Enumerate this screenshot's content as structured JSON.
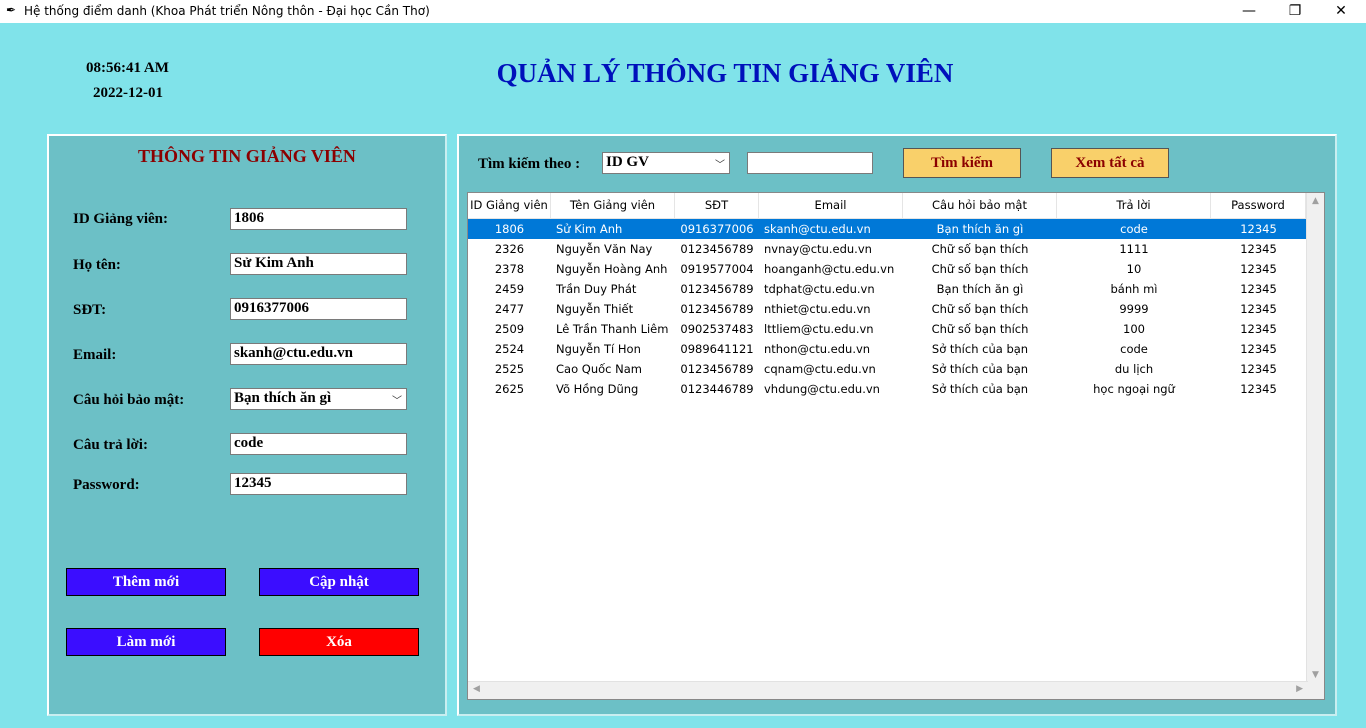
{
  "window": {
    "title": "Hệ thống điểm danh (Khoa Phát triển Nông thôn - Đại học Cần Thơ)",
    "app_icon": "feather-icon",
    "min_glyph": "—",
    "max_glyph": "❐",
    "close_glyph": "✕"
  },
  "clock": {
    "time": "08:56:41 AM",
    "date": "2022-12-01"
  },
  "page_title": "QUẢN LÝ THÔNG TIN GIẢNG VIÊN",
  "form": {
    "title": "THÔNG TIN GIẢNG VIÊN",
    "id_label": "ID Giảng viên:",
    "id_value": "1806",
    "name_label": "Họ tên:",
    "name_value": "Sử Kim Anh",
    "phone_label": "SĐT:",
    "phone_value": "0916377006",
    "email_label": "Email:",
    "email_value": "skanh@ctu.edu.vn",
    "question_label": "Câu hỏi bảo mật:",
    "question_value": "Bạn thích ăn gì",
    "answer_label": "Câu trả lời:",
    "answer_value": "code",
    "password_label": "Password:",
    "password_value": "12345"
  },
  "buttons": {
    "add": "Thêm mới",
    "update": "Cập nhật",
    "reset": "Làm mới",
    "delete": "Xóa"
  },
  "search": {
    "label": "Tìm kiếm theo :",
    "by_value": "ID GV",
    "query_value": "",
    "search_button": "Tìm kiếm",
    "show_all_button": "Xem tất cả"
  },
  "table": {
    "columns": [
      "ID Giảng viên",
      "Tên Giảng viên",
      "SĐT",
      "Email",
      "Câu hỏi bảo mật",
      "Trả lời",
      "Password"
    ],
    "rows": [
      [
        "1806",
        "Sử Kim Anh",
        "0916377006",
        "skanh@ctu.edu.vn",
        "Bạn thích ăn gì",
        "code",
        "12345"
      ],
      [
        "2326",
        "Nguyễn Văn Nay",
        "0123456789",
        "nvnay@ctu.edu.vn",
        "Chữ số bạn thích",
        "1111",
        "12345"
      ],
      [
        "2378",
        "Nguyễn Hoàng Anh",
        "0919577004",
        "hoanganh@ctu.edu.vn",
        "Chữ số bạn thích",
        "10",
        "12345"
      ],
      [
        "2459",
        "Trần Duy Phát",
        "0123456789",
        "tdphat@ctu.edu.vn",
        "Bạn thích ăn gì",
        "bánh mì",
        "12345"
      ],
      [
        "2477",
        "Nguyễn Thiết",
        "0123456789",
        "nthiet@ctu.edu.vn",
        "Chữ số bạn thích",
        "9999",
        "12345"
      ],
      [
        "2509",
        "Lê Trần Thanh Liêm",
        "0902537483",
        "lttliem@ctu.edu.vn",
        "Chữ số bạn thích",
        "100",
        "12345"
      ],
      [
        "2524",
        "Nguyễn Tí Hon",
        "0989641121",
        "nthon@ctu.edu.vn",
        "Sở thích của bạn",
        "code",
        "12345"
      ],
      [
        "2525",
        "Cao Quốc Nam",
        "0123456789",
        "cqnam@ctu.edu.vn",
        "Sở thích của bạn",
        "du lịch",
        "12345"
      ],
      [
        "2625",
        "Võ Hồng Dũng",
        "0123446789",
        "vhdung@ctu.edu.vn",
        "Sở thích của bạn",
        "học ngoại ngữ",
        "12345"
      ]
    ],
    "selected_row": 0
  },
  "colors": {
    "background": "#80e3ea",
    "panel": "#6cc0c6",
    "title_blue": "#0011bb",
    "panel_title_red": "#8b0000",
    "button_blue": "#3b0dff",
    "button_red": "#ff0000",
    "button_yellow": "#f9d06a",
    "selection": "#0078d7"
  }
}
